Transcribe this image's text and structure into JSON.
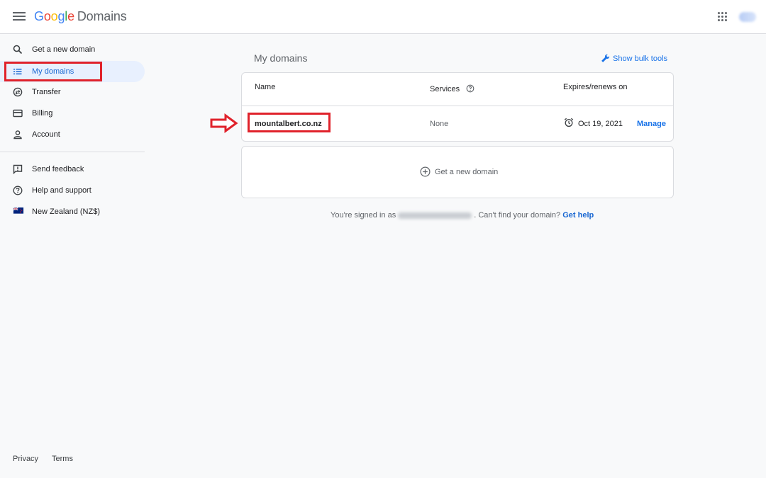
{
  "header": {
    "logo_google": [
      "G",
      "o",
      "o",
      "g",
      "l",
      "e"
    ],
    "product": "Domains"
  },
  "sidebar": {
    "items": [
      {
        "label": "Get a new domain",
        "icon": "search-icon"
      },
      {
        "label": "My domains",
        "icon": "list-icon"
      },
      {
        "label": "Transfer",
        "icon": "transfer-icon"
      },
      {
        "label": "Billing",
        "icon": "credit-card-icon"
      },
      {
        "label": "Account",
        "icon": "person-icon"
      },
      {
        "label": "Send feedback",
        "icon": "feedback-icon"
      },
      {
        "label": "Help and support",
        "icon": "help-icon"
      },
      {
        "label": "New Zealand (NZ$)",
        "icon": "nz-flag-icon"
      }
    ],
    "footer": {
      "privacy": "Privacy",
      "terms": "Terms"
    }
  },
  "main": {
    "title": "My domains",
    "bulk_tools": "Show bulk tools",
    "table": {
      "headers": {
        "name": "Name",
        "services": "Services",
        "expires": "Expires/renews on"
      },
      "rows": [
        {
          "name": "mountalbert.co.nz",
          "services": "None",
          "expires": "Oct 19, 2021",
          "action": "Manage"
        }
      ]
    },
    "add_domain": "Get a new domain",
    "signed_in_prefix": "You're signed in as",
    "signed_in_suffix": ". Can't find your domain?",
    "get_help": "Get help"
  },
  "colors": {
    "accent": "#1a73e8",
    "highlight": "#e0222b",
    "active_bg": "#e8f0fe"
  }
}
